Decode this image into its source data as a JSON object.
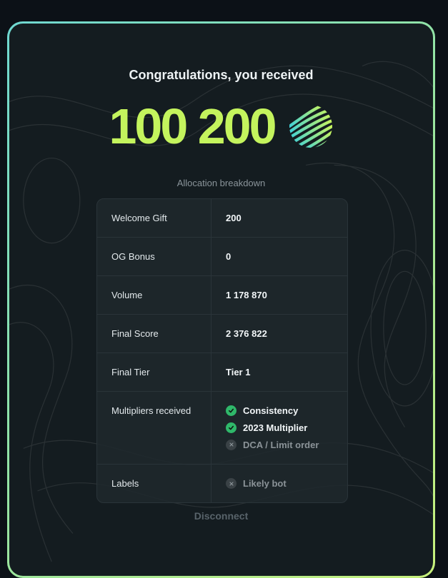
{
  "heading": "Congratulations, you received",
  "amount": "100 200",
  "breakdown_label": "Allocation breakdown",
  "rows": [
    {
      "label": "Welcome Gift",
      "value": "200"
    },
    {
      "label": "OG Bonus",
      "value": "0"
    },
    {
      "label": "Volume",
      "value": "1 178 870"
    },
    {
      "label": "Final Score",
      "value": "2 376 822"
    },
    {
      "label": "Final Tier",
      "value": "Tier 1"
    }
  ],
  "multipliers": {
    "label": "Multipliers received",
    "items": [
      {
        "name": "Consistency",
        "received": true
      },
      {
        "name": "2023 Multiplier",
        "received": true
      },
      {
        "name": "DCA / Limit order",
        "received": false
      }
    ]
  },
  "labels": {
    "label": "Labels",
    "items": [
      {
        "name": "Likely bot",
        "received": false
      }
    ]
  },
  "disconnect_label": "Disconnect",
  "colors": {
    "accent": "#c4f45d",
    "check": "#2fb86a",
    "border_gradient_start": "#6fd8d1",
    "border_gradient_end": "#c7f07b"
  },
  "icons": {
    "logo": "striped-sphere-logo",
    "received": "check-circle-icon",
    "not_received": "x-circle-icon"
  }
}
